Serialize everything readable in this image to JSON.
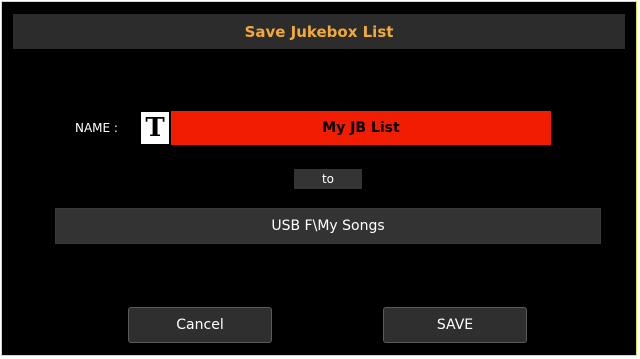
{
  "dialog": {
    "title": "Save Jukebox List"
  },
  "name": {
    "label": "NAME :",
    "text_icon_glyph": "T",
    "value": "My JB List"
  },
  "destination": {
    "to_label": "to",
    "path": "USB F\\My Songs"
  },
  "buttons": {
    "cancel_label": "Cancel",
    "save_label": "SAVE"
  },
  "colors": {
    "title_text": "#f2a93b",
    "name_field_bg": "#f21c00",
    "dialog_border": "#d9e85a",
    "dialog_bg": "#000000"
  }
}
